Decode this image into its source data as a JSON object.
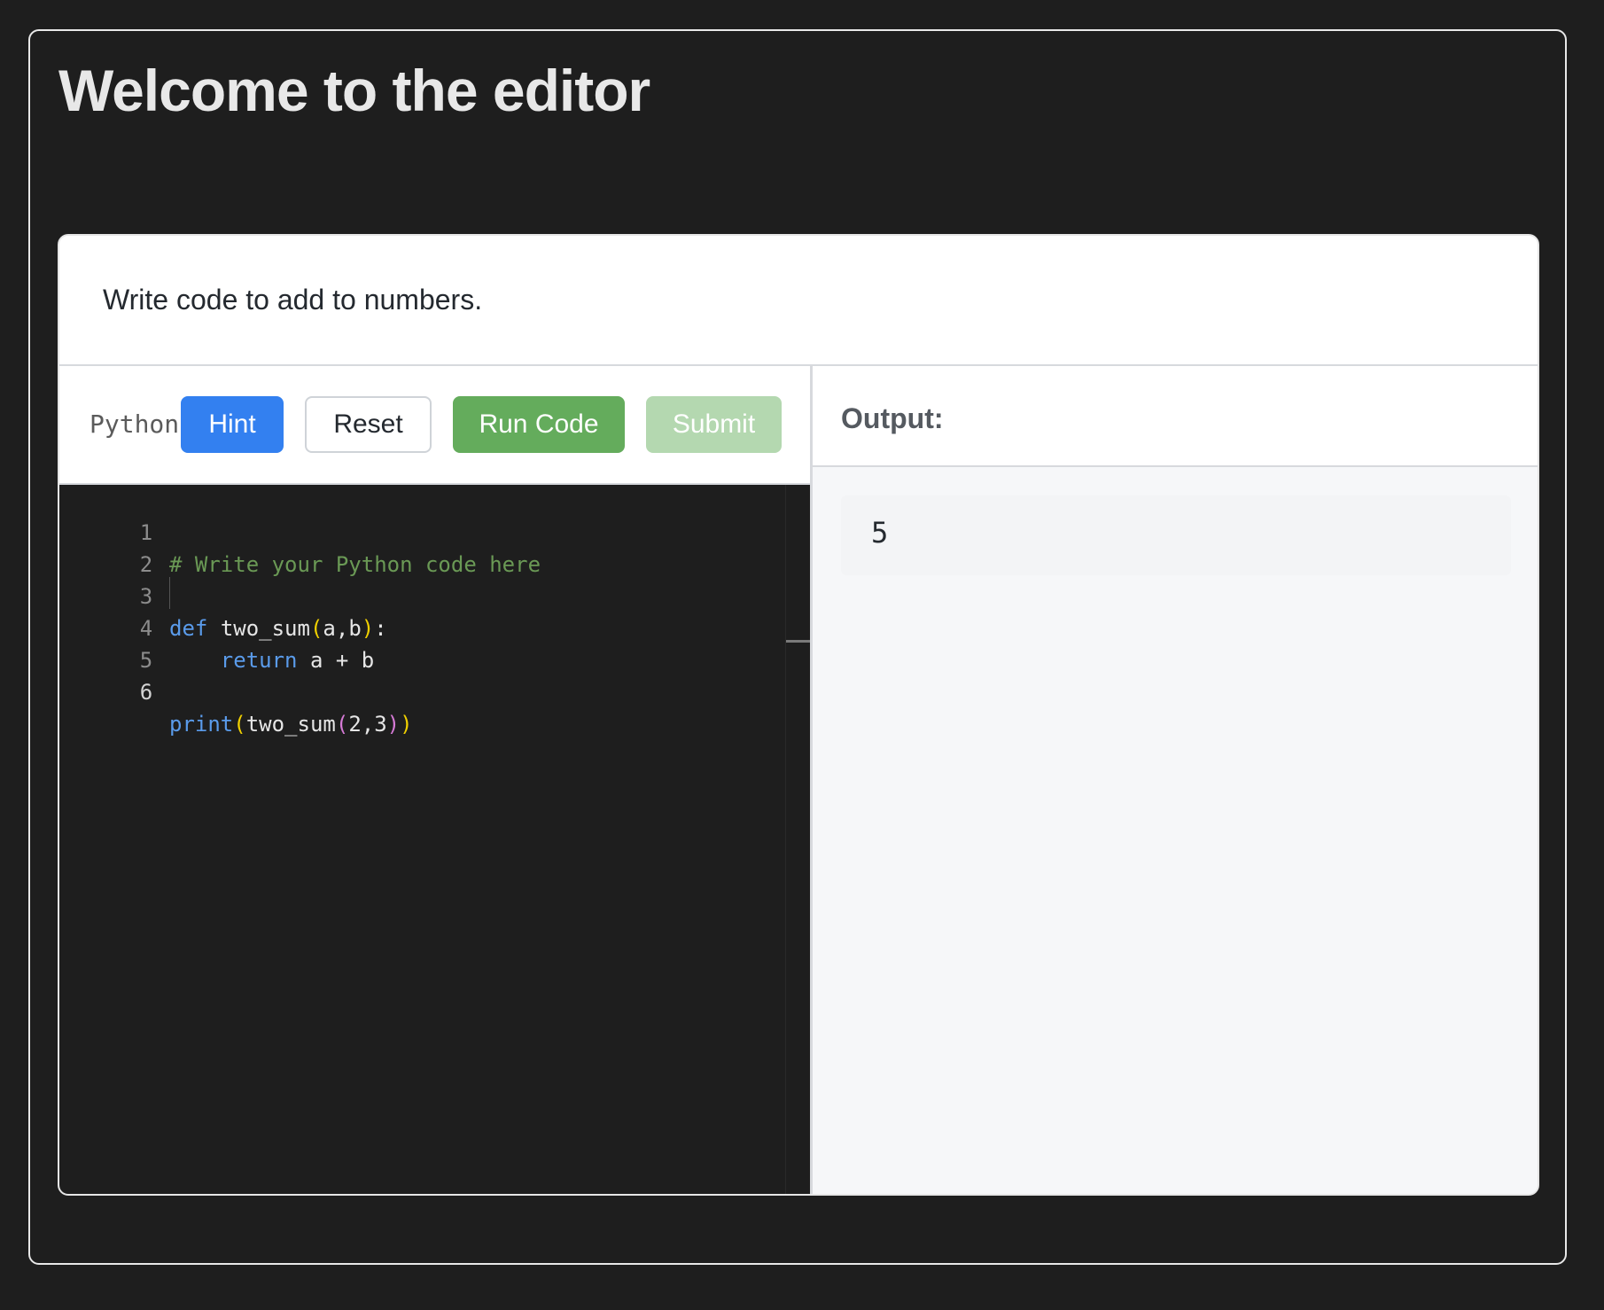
{
  "page": {
    "title": "Welcome to the editor"
  },
  "prompt": {
    "text": "Write code to add to numbers."
  },
  "toolbar": {
    "language": "Python",
    "hint_label": "Hint",
    "reset_label": "Reset",
    "run_label": "Run Code",
    "submit_label": "Submit"
  },
  "editor": {
    "line_numbers": [
      "1",
      "2",
      "3",
      "4",
      "5",
      "6"
    ],
    "active_line": 6,
    "lines": [
      {
        "comment": "# Write your Python code here"
      },
      {},
      {
        "kw": "def",
        "sp": " ",
        "name": "two_sum",
        "open": "(",
        "args": "a,b",
        "close": ")",
        "tail": ":"
      },
      {
        "indent": "    ",
        "kw": "return",
        "rest": " a + b"
      },
      {},
      {
        "fn": "print",
        "open1": "(",
        "inner": "two_sum",
        "open2": "(",
        "args": "2,3",
        "close2": ")",
        "close1": ")"
      }
    ]
  },
  "output": {
    "label": "Output:",
    "value": "5"
  },
  "colors": {
    "hint": "#3380f0",
    "run": "#64ac5c",
    "submit_disabled": "#b4d8b0",
    "background": "#1e1e1e"
  }
}
